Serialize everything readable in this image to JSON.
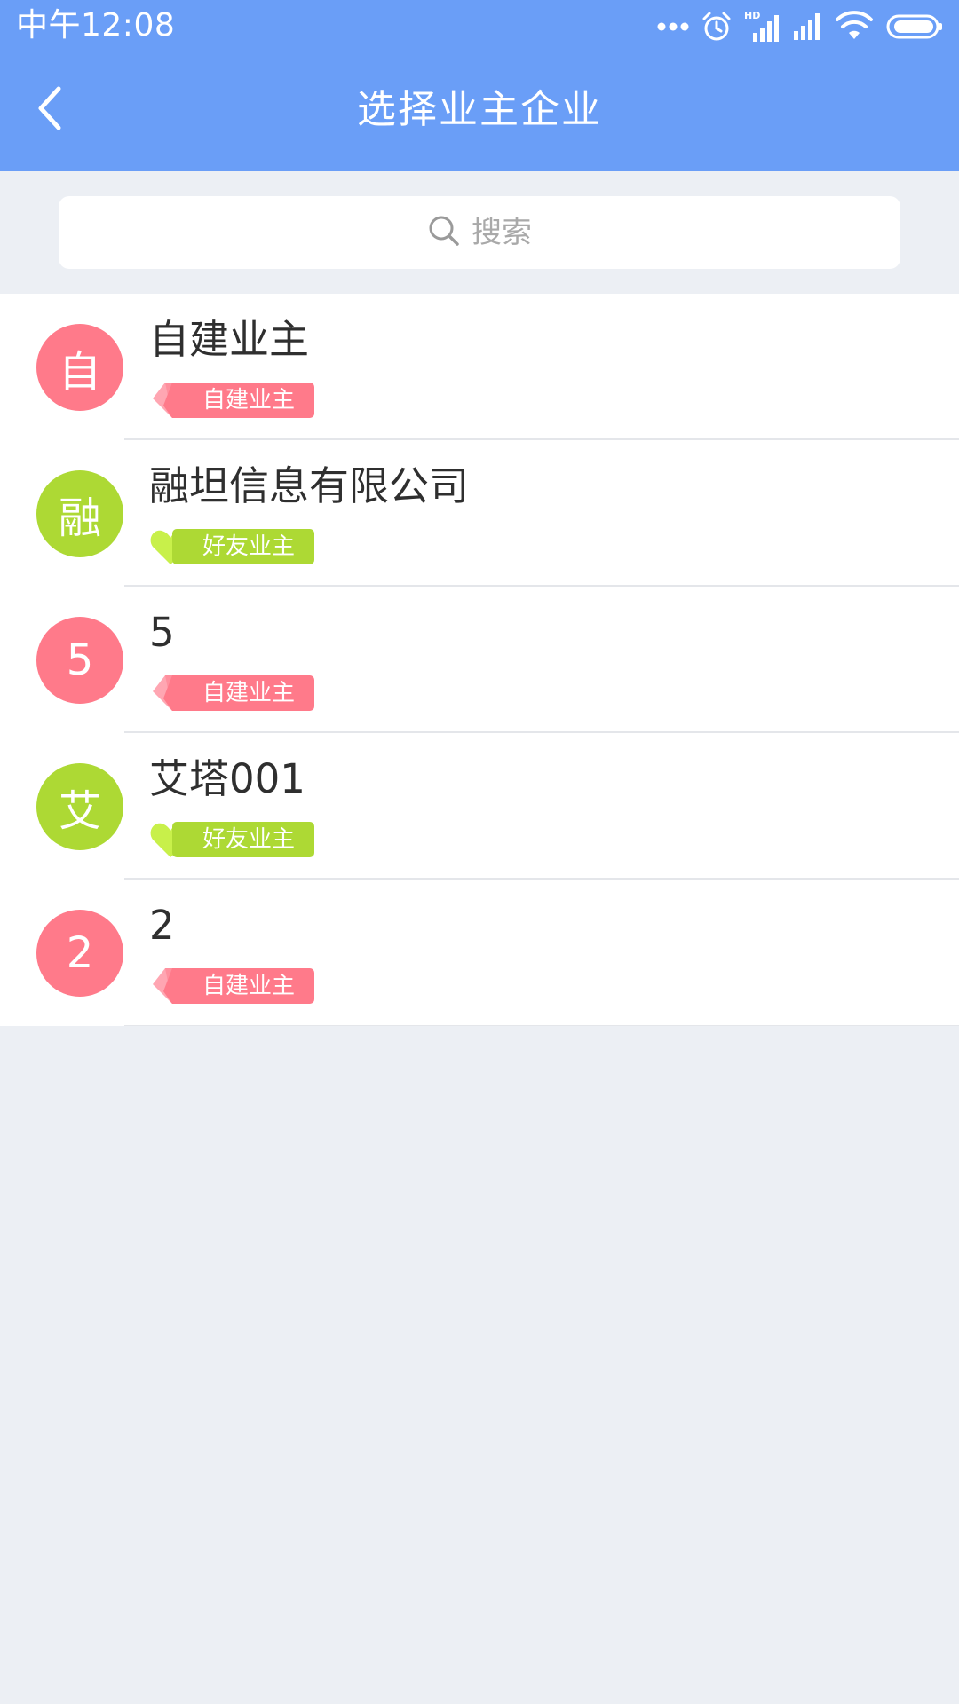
{
  "status_bar": {
    "time": "中午12:08",
    "icons": [
      "more-dots-icon",
      "alarm-icon",
      "hd-signal-icon",
      "signal-icon",
      "wifi-icon",
      "battery-icon"
    ]
  },
  "nav": {
    "back_icon": "chevron-left-icon",
    "title": "选择业主企业"
  },
  "search": {
    "icon": "search-icon",
    "placeholder": "搜索"
  },
  "colors": {
    "primary": "#6A9EF7",
    "background": "#ECEFF4",
    "pink": "#FF7A8A",
    "pink_light": "#FFA6B2",
    "green": "#ADD934",
    "green_light": "#C8F04A",
    "text": "#2F2F2F",
    "placeholder": "#A9A9A9"
  },
  "owners": [
    {
      "avatar": "自",
      "name": "自建业主",
      "tag": "自建业主",
      "type": "self-built"
    },
    {
      "avatar": "融",
      "name": "融坦信息有限公司",
      "tag": "好友业主",
      "type": "friend"
    },
    {
      "avatar": "5",
      "name": "5",
      "tag": "自建业主",
      "type": "self-built"
    },
    {
      "avatar": "艾",
      "name": "艾塔001",
      "tag": "好友业主",
      "type": "friend"
    },
    {
      "avatar": "2",
      "name": "2",
      "tag": "自建业主",
      "type": "self-built"
    }
  ]
}
